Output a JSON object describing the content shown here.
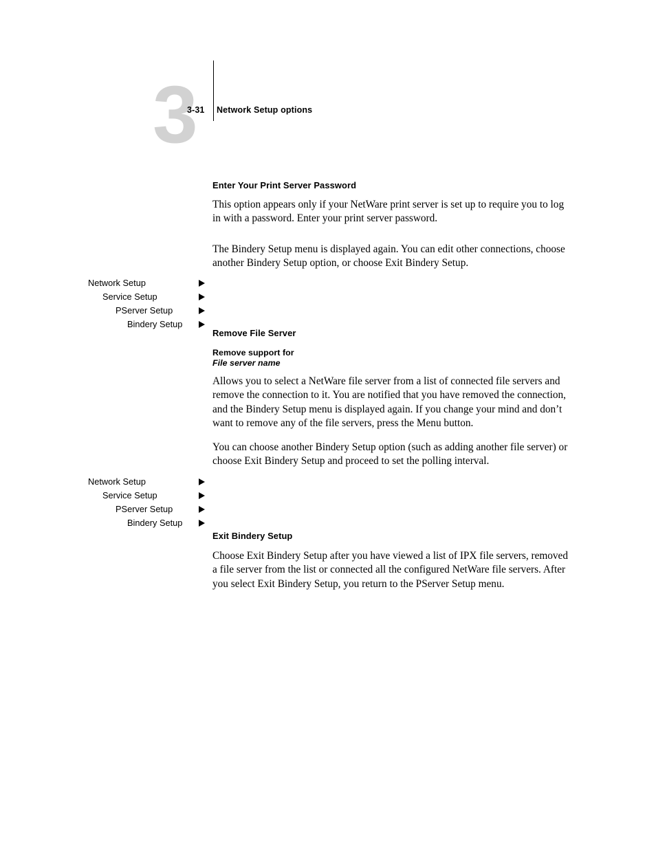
{
  "page": {
    "chapter_number": "3",
    "folio": "3-31",
    "running_head": "Network Setup options"
  },
  "sections": [
    {
      "heading": "Enter Your Print Server Password",
      "paragraphs": [
        "This option appears only if your NetWare print server is set up to require you to log in with a password. Enter your print server password.",
        "The Bindery Setup menu is displayed again. You can edit other connections, choose another Bindery Setup option, or choose Exit Bindery Setup."
      ]
    },
    {
      "heading": "Remove File Server",
      "option_label": "Remove support for",
      "option_value": "File server name",
      "paragraphs": [
        "Allows you to select a NetWare file server from a list of connected file servers and remove the connection to it. You are notified that you have removed the connection, and the Bindery Setup menu is displayed again. If you change your mind and don’t want to remove any of the file servers, press the Menu button.",
        "You can choose another Bindery Setup option (such as adding another file server) or choose Exit Bindery Setup and proceed to set the polling interval."
      ]
    },
    {
      "heading": "Exit Bindery Setup",
      "paragraphs": [
        "Choose Exit Bindery Setup after you have viewed a list of IPX file servers, removed a file server from the list or connected all the configured NetWare file servers. After you select Exit Bindery Setup, you return to the PServer Setup menu."
      ]
    }
  ],
  "menu_paths": [
    {
      "items": [
        {
          "label": "Network Setup",
          "indent": 128
        },
        {
          "label": "Service Setup",
          "indent": 149
        },
        {
          "label": "PServer Setup",
          "indent": 168
        },
        {
          "label": "Bindery Setup",
          "indent": 185
        }
      ]
    },
    {
      "items": [
        {
          "label": "Network Setup",
          "indent": 128
        },
        {
          "label": "Service Setup",
          "indent": 149
        },
        {
          "label": "PServer Setup",
          "indent": 168
        },
        {
          "label": "Bindery Setup",
          "indent": 185
        }
      ]
    }
  ],
  "colors": {
    "chapter_number": "#d2d2d2",
    "text": "#000000",
    "background": "#ffffff"
  }
}
